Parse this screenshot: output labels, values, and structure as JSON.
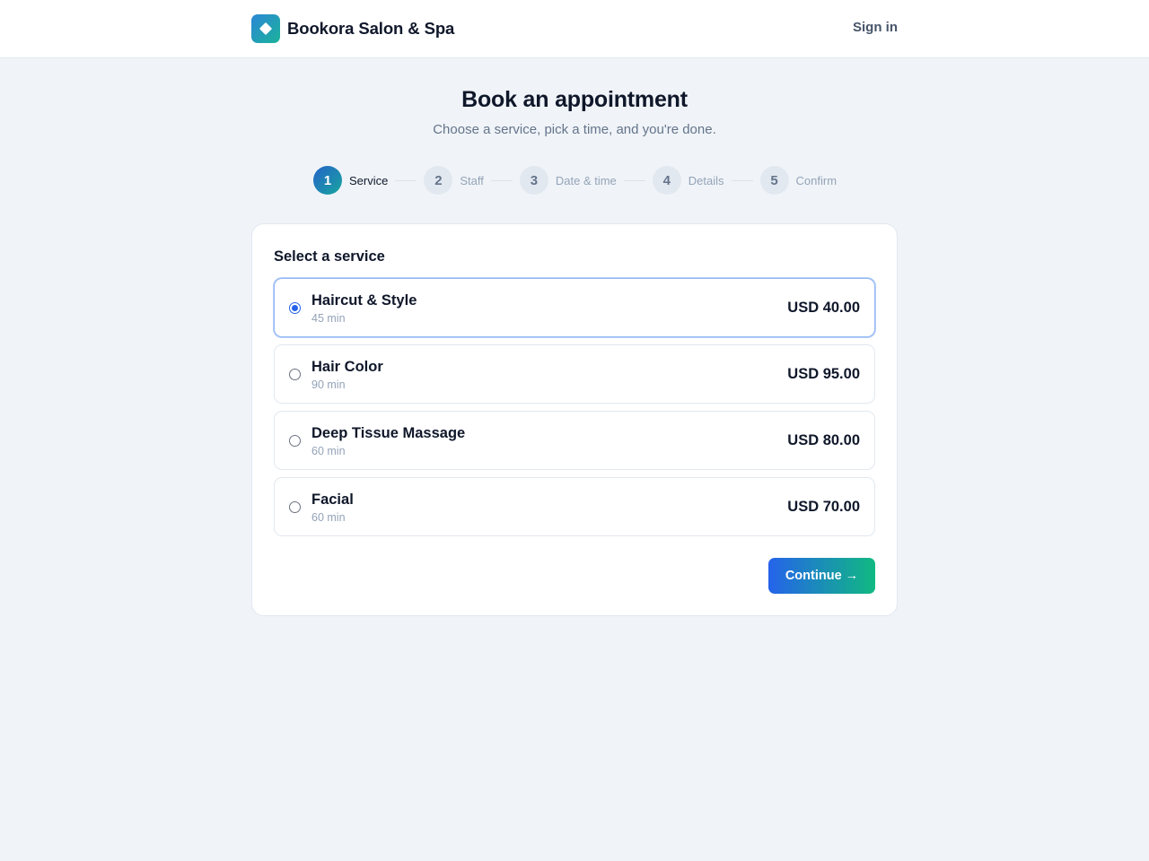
{
  "header": {
    "brand_name": "Bookora Salon & Spa",
    "logo_icon": "diamond-logo-icon",
    "sign_in_label": "Sign in"
  },
  "hero": {
    "title": "Book an appointment",
    "subtitle": "Choose a service, pick a time, and you're done."
  },
  "stepper": {
    "current_step": 1,
    "steps": [
      {
        "number": "1",
        "label": "Service"
      },
      {
        "number": "2",
        "label": "Staff"
      },
      {
        "number": "3",
        "label": "Date & time"
      },
      {
        "number": "4",
        "label": "Details"
      },
      {
        "number": "5",
        "label": "Confirm"
      }
    ]
  },
  "services": {
    "heading": "Select a service",
    "selected": "Haircut & Style",
    "items": [
      {
        "name": "Haircut & Style",
        "duration": "45 min",
        "price": "USD 40.00"
      },
      {
        "name": "Hair Color",
        "duration": "90 min",
        "price": "USD 95.00"
      },
      {
        "name": "Deep Tissue Massage",
        "duration": "60 min",
        "price": "USD 80.00"
      },
      {
        "name": "Facial",
        "duration": "60 min",
        "price": "USD 70.00"
      }
    ]
  },
  "actions": {
    "continue_label": "Continue",
    "continue_icon": "→"
  },
  "colors": {
    "accent_blue": "#2563eb",
    "accent_green": "#10b981",
    "background": "#f0f4f8"
  }
}
